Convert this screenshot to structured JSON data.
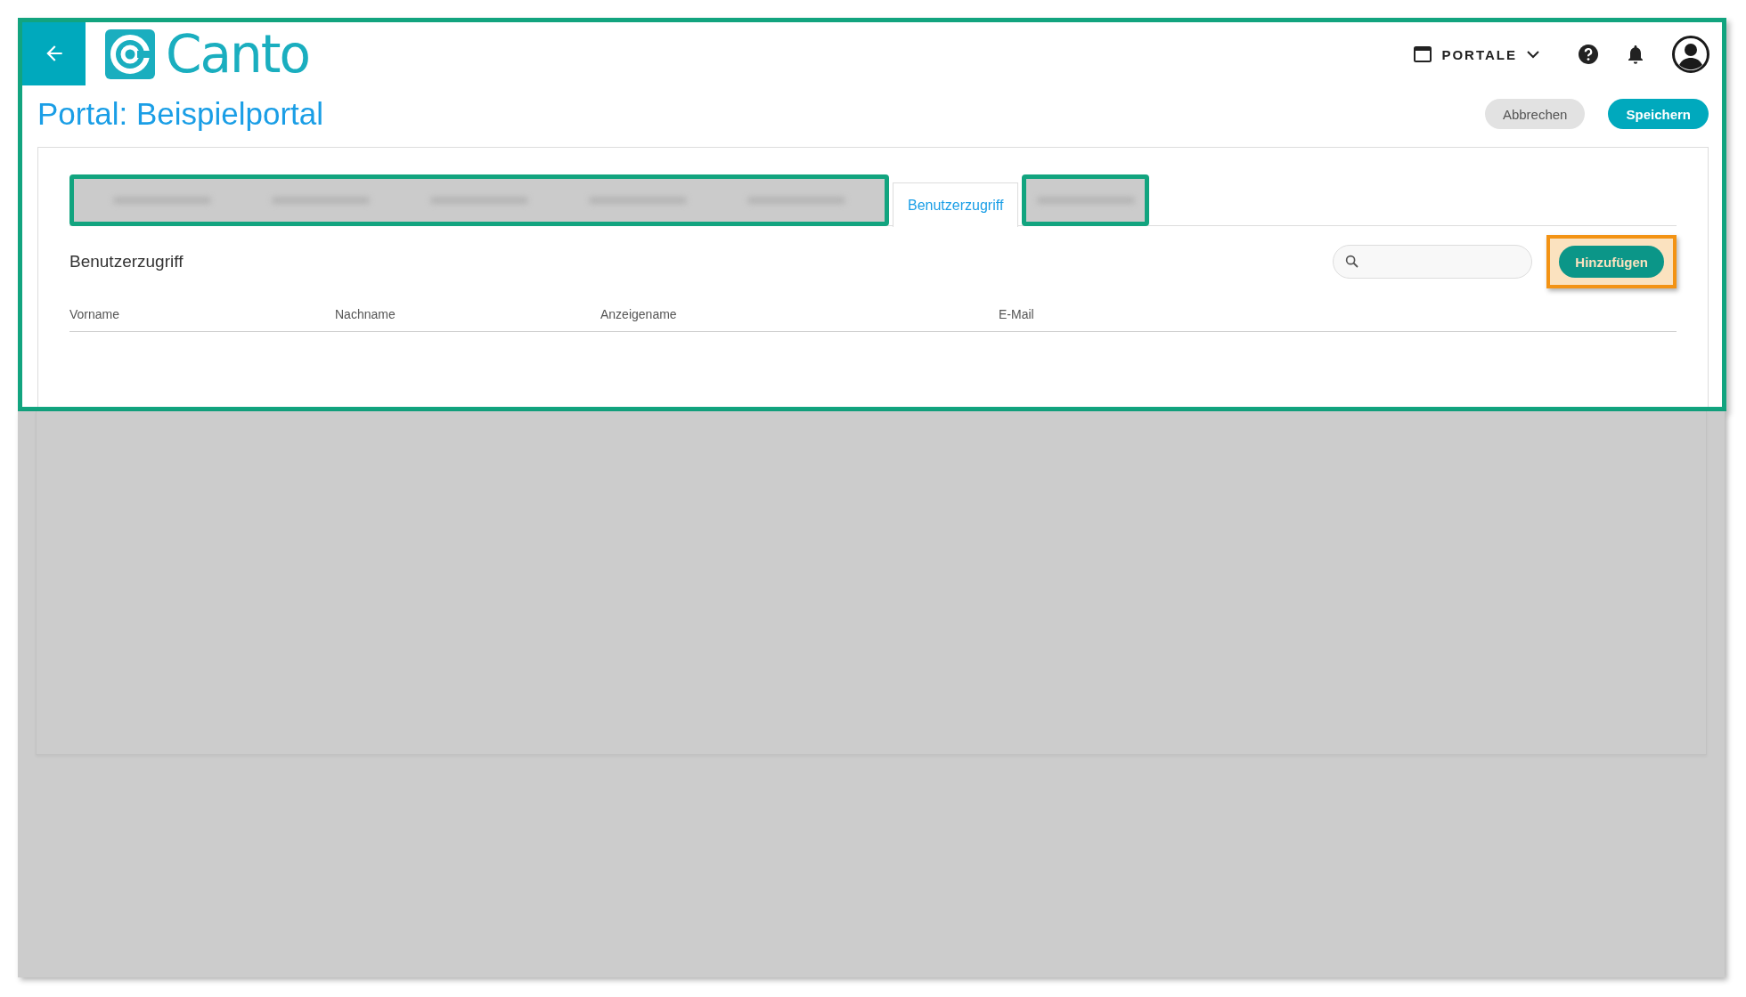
{
  "header": {
    "logo_text": "Canto",
    "portals_label": "PORTALE"
  },
  "page": {
    "title": "Portal: Beispielportal",
    "buttons": [
      {
        "kind": "secondary",
        "label": "Abbrechen"
      },
      {
        "kind": "primary",
        "label": "Speichern"
      }
    ]
  },
  "tabs": [
    {
      "kind": "redacted_wide"
    },
    {
      "kind": "tab",
      "label": "Benutzerzugriff",
      "selected": true
    },
    {
      "kind": "redacted_narrow"
    }
  ],
  "section": {
    "title": "Benutzerzugriff",
    "add_button": {
      "label": "Hinzufügen",
      "highlighted": true
    }
  },
  "table": {
    "columns": [
      "Vorname",
      "Nachname",
      "Anzeigename",
      "E-Mail"
    ]
  },
  "dimmed": true
}
